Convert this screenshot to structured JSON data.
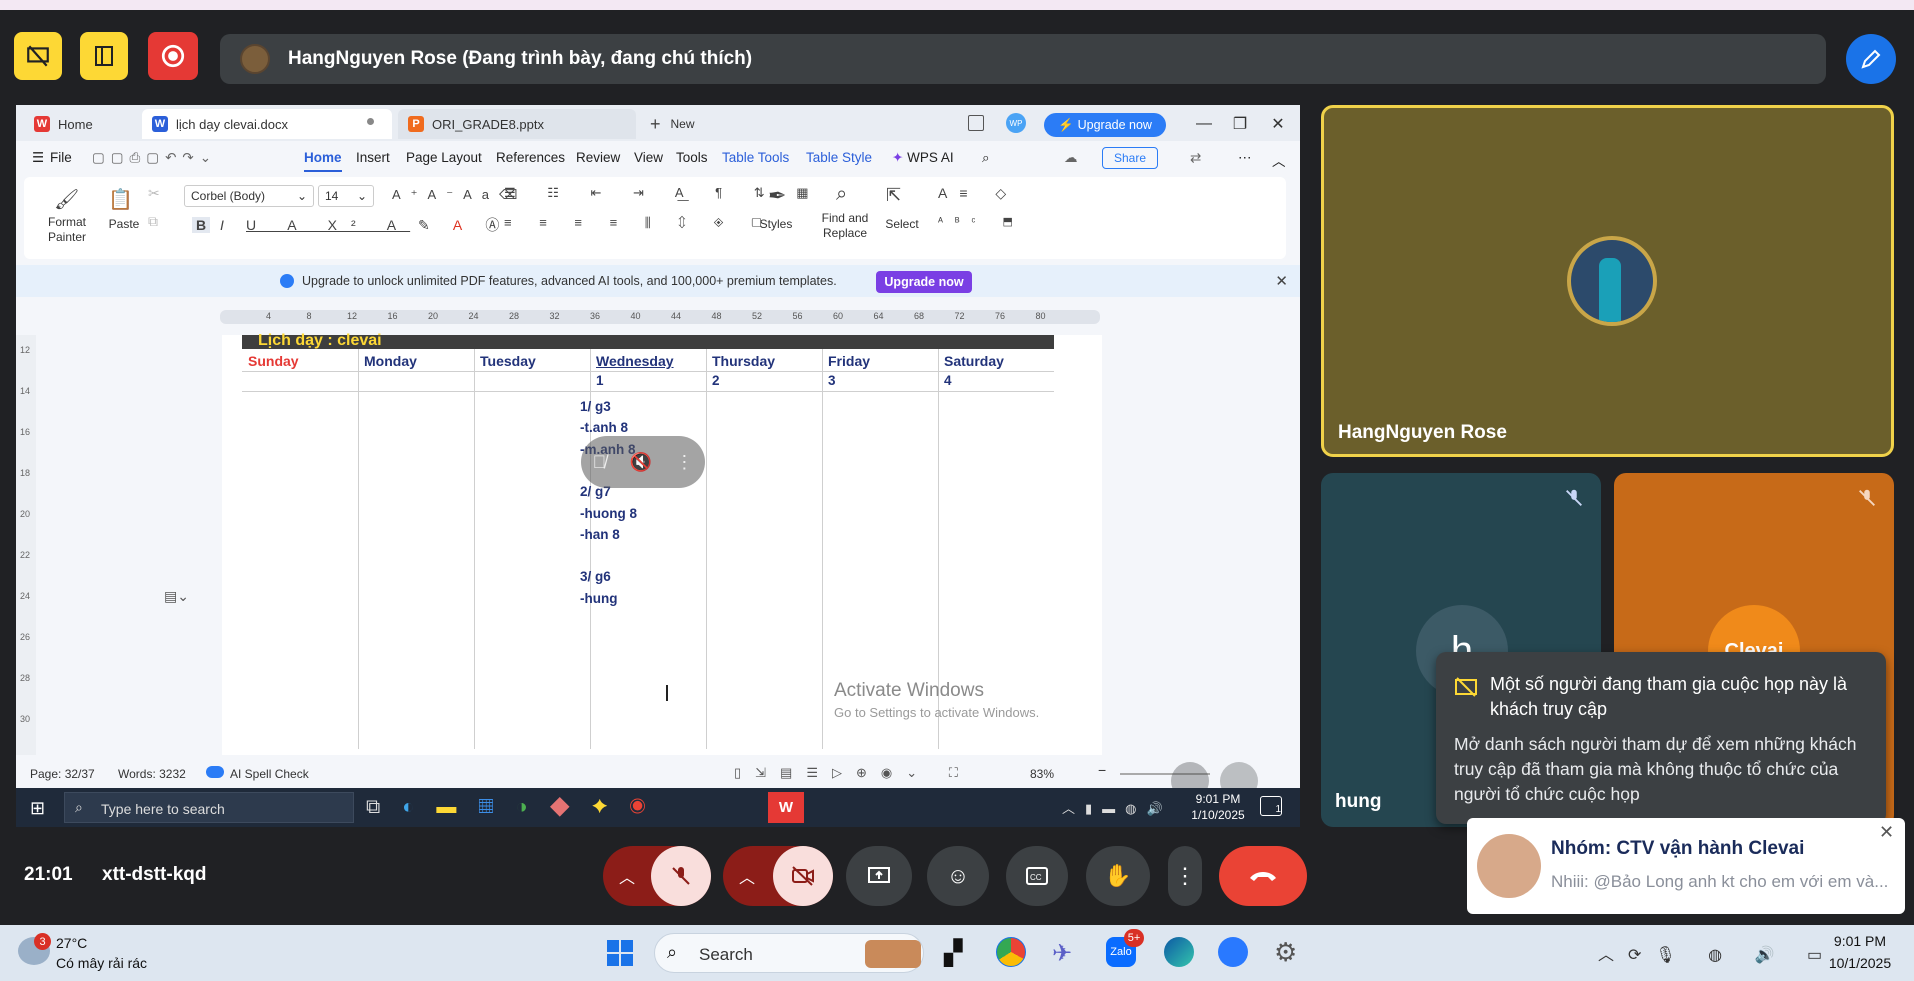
{
  "meet": {
    "presenter_title": "HangNguyen Rose (Đang trình bày, đang chú thích)",
    "meeting_time": "21:01",
    "meeting_code": "xtt-dstt-kqd"
  },
  "browser_tabs": [
    {
      "label": "Home"
    },
    {
      "label": "lịch dạy clevai.docx"
    },
    {
      "label": "ORI_GRADE8.pptx"
    },
    {
      "label": "New"
    }
  ],
  "wps": {
    "upgrade_label": "Upgrade now",
    "avatar_initials": "WP",
    "menu": {
      "file": "File",
      "items": [
        "Home",
        "Insert",
        "Page Layout",
        "References",
        "Review",
        "View",
        "Tools",
        "Table Tools",
        "Table Style",
        "WPS AI"
      ],
      "share": "Share"
    },
    "ribbon": {
      "format_painter": "Format Painter",
      "paste": "Paste",
      "font_name": "Corbel (Body)",
      "font_size": "14",
      "styles": "Styles",
      "find_replace": "Find and Replace",
      "select": "Select"
    },
    "notice": {
      "text": "Upgrade to unlock unlimited PDF features, advanced AI tools, and 100,000+ premium templates.",
      "button": "Upgrade now"
    },
    "ruler_ticks": [
      "4",
      "8",
      "12",
      "16",
      "20",
      "24",
      "28",
      "32",
      "36",
      "40",
      "44",
      "48",
      "52",
      "56",
      "60",
      "64",
      "68",
      "72",
      "76",
      "80"
    ],
    "vruler_ticks": [
      "12",
      "14",
      "16",
      "18",
      "20",
      "22",
      "24",
      "26",
      "28",
      "30"
    ],
    "doc": {
      "header_text": "Lịch dạy : clevai",
      "days": [
        "Sunday",
        "Monday",
        "Tuesday",
        "Wednesday",
        "Thursday",
        "Friday",
        "Saturday"
      ],
      "dates": [
        "",
        "",
        "",
        "1",
        "2",
        "3",
        "4"
      ],
      "wednesday_notes": [
        "1/ g3",
        "-t.anh 8",
        "-m.anh 8",
        "",
        "2/ g7",
        "-huong 8",
        "-han 8",
        "",
        "3/ g6",
        "-hung"
      ]
    },
    "activate": {
      "title": "Activate Windows",
      "subtitle": "Go to Settings to activate Windows."
    },
    "status": {
      "page": "Page: 32/37",
      "words": "Words: 3232",
      "spell": "AI Spell Check",
      "zoom": "83%"
    },
    "inner_taskbar": {
      "search_placeholder": "Type here to search",
      "time": "9:01 PM",
      "date": "1/10/2025",
      "notif_count": "1"
    }
  },
  "participants": {
    "main_name": "HangNguyen Rose",
    "tile2_name": "hung",
    "tile2_initial": "h",
    "tile3_name": "Clevai"
  },
  "guest_popup": {
    "title": "Một số người đang tham gia cuộc họp này là khách truy cập",
    "body": "Mở danh sách người tham dự để xem những khách truy cập đã tham gia mà không thuộc tổ chức của người tổ chức cuộc họp"
  },
  "chat_toast": {
    "title": "Nhóm: CTV vận hành Clevai",
    "message": "Nhiii: @Bảo Long anh kt cho em với em và..."
  },
  "windows": {
    "weather_temp": "27°C",
    "weather_desc": "Có mây rải rác",
    "weather_badge": "3",
    "search": "Search",
    "zalo_badge": "5+",
    "time": "9:01 PM",
    "date": "10/1/2025"
  },
  "colors": {
    "meet_bg": "#202124",
    "leave_red": "#ea4335",
    "muted_red": "#f9dedc",
    "accent_blue": "#1a73e8"
  }
}
